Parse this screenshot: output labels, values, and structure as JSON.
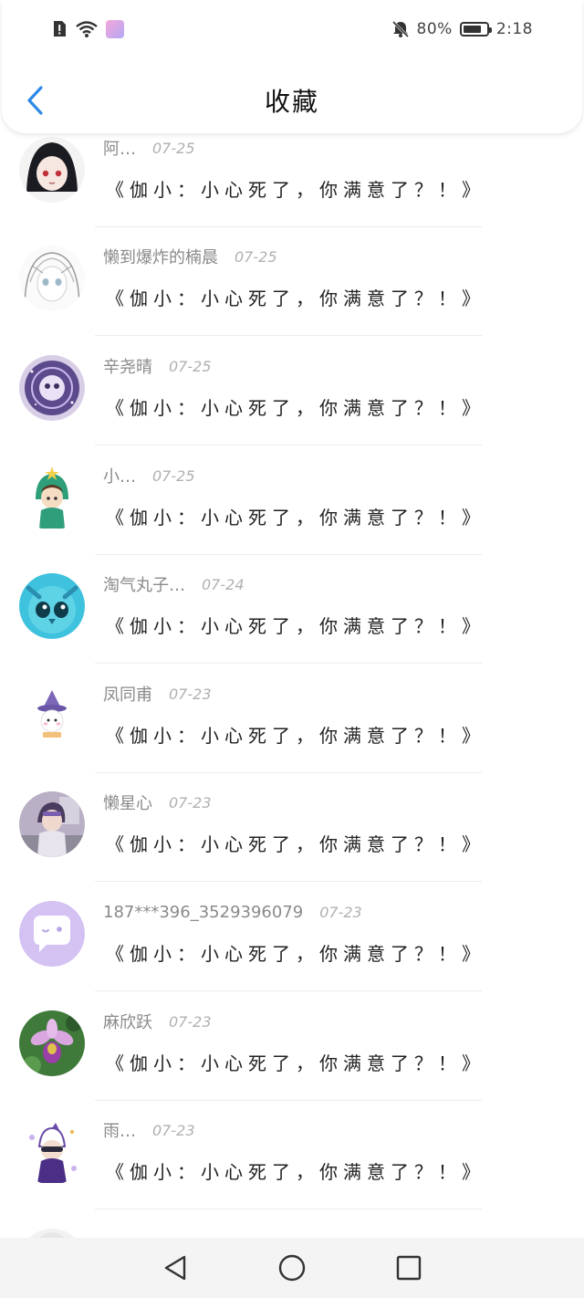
{
  "status_bar": {
    "battery": "80%",
    "battery_level": 0.8,
    "time": "2:18",
    "icons": [
      "alert-icon",
      "wifi-icon",
      "app-icon",
      "mute-bell-icon",
      "battery-icon"
    ]
  },
  "header": {
    "title": "收藏",
    "back_icon": "chevron-left-icon",
    "accent_color": "#2e8ae6"
  },
  "items": [
    {
      "username": "阿…",
      "date": "07-25",
      "message": "《伽小：小心死了，你满意了？！》",
      "avatar": "dark-hair-anime-avatar"
    },
    {
      "username": "懒到爆炸的楠晨",
      "date": "07-25",
      "message": "《伽小：小心死了，你满意了？！》",
      "avatar": "sketch-anime-avatar"
    },
    {
      "username": "辛尧晴",
      "date": "07-25",
      "message": "《伽小：小心死了，你满意了？！》",
      "avatar": "galaxy-avatar"
    },
    {
      "username": "小…",
      "date": "07-25",
      "message": "《伽小：小心死了，你满意了？！》",
      "avatar": "green-hood-avatar"
    },
    {
      "username": "淘气丸子…",
      "date": "07-24",
      "message": "《伽小：小心死了，你满意了？！》",
      "avatar": "blue-owl-avatar"
    },
    {
      "username": "凤同甫",
      "date": "07-23",
      "message": "《伽小：小心死了，你满意了？！》",
      "avatar": "witch-hat-avatar"
    },
    {
      "username": "懒星心",
      "date": "07-23",
      "message": "《伽小：小心死了，你满意了？！》",
      "avatar": "room-anime-avatar"
    },
    {
      "username": "187***396_3529396079",
      "date": "07-23",
      "message": "《伽小：小心死了，你满意了？！》",
      "avatar": "chat-bubble-avatar"
    },
    {
      "username": "麻欣跃",
      "date": "07-23",
      "message": "《伽小：小心死了，你满意了？！》",
      "avatar": "orchid-avatar"
    },
    {
      "username": "雨…",
      "date": "07-23",
      "message": "《伽小：小心死了，你满意了？！》",
      "avatar": "purple-hero-avatar"
    }
  ],
  "nav_bar": {
    "back": "triangle-back-icon",
    "home": "circle-home-icon",
    "recents": "square-recents-icon"
  }
}
